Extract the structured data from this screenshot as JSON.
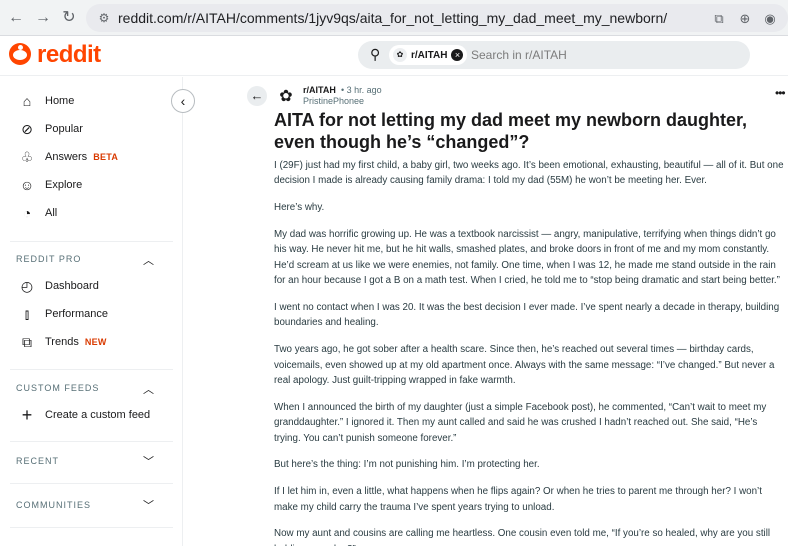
{
  "browser": {
    "url_domain": "reddit.com",
    "url_path": "/r/AITAH/comments/1jyv9qs/aita_for_not_letting_my_dad_meet_my_newborn/"
  },
  "header": {
    "logo_text": "reddit",
    "search_chip": "r/AITAH",
    "search_placeholder": "Search in r/AITAH"
  },
  "sidebar": {
    "nav": [
      {
        "label": "Home",
        "icon": "home-icon"
      },
      {
        "label": "Popular",
        "icon": "popular-icon"
      },
      {
        "label": "Answers",
        "badge": "BETA",
        "icon": "answers-icon"
      },
      {
        "label": "Explore",
        "icon": "explore-icon"
      },
      {
        "label": "All",
        "icon": "all-icon"
      }
    ],
    "reddit_pro_header": "REDDIT PRO",
    "pro": [
      {
        "label": "Dashboard",
        "icon": "dashboard-icon"
      },
      {
        "label": "Performance",
        "icon": "performance-icon"
      },
      {
        "label": "Trends",
        "badge": "NEW",
        "icon": "trends-icon"
      }
    ],
    "custom_feeds_header": "CUSTOM FEEDS",
    "create_feed": "Create a custom feed",
    "recent_header": "RECENT",
    "communities_header": "COMMUNITIES"
  },
  "post": {
    "subreddit": "r/AITAH",
    "time": "• 3 hr. ago",
    "author": "PristinePhonee",
    "title": "AITA for not letting my dad meet my newborn daughter, even though he’s “changed”?",
    "paragraphs": [
      "I (29F) just had my first child, a baby girl, two weeks ago. It’s been emotional, exhausting, beautiful — all of it. But one decision I made is already causing family drama: I told my dad (55M) he won’t be meeting her. Ever.",
      "Here’s why.",
      "My dad was horrific growing up. He was a textbook narcissist — angry, manipulative, terrifying when things didn’t go his way. He never hit me, but he hit walls, smashed plates, and broke doors in front of me and my mom constantly. He’d scream at us like we were enemies, not family. One time, when I was 12, he made me stand outside in the rain for an hour because I got a B on a math test. When I cried, he told me to “stop being dramatic and start being better.”",
      "I went no contact when I was 20. It was the best decision I ever made. I’ve spent nearly a decade in therapy, building boundaries and healing.",
      "Two years ago, he got sober after a health scare. Since then, he’s reached out several times — birthday cards, voicemails, even showed up at my old apartment once. Always with the same message: “I’ve changed.” But never a real apology. Just guilt-tripping wrapped in fake warmth.",
      "When I announced the birth of my daughter (just a simple Facebook post), he commented, “Can’t wait to meet my granddaughter.” I ignored it. Then my aunt called and said he was crushed I hadn’t reached out. She said, “He’s trying. You can’t punish someone forever.”",
      "But here’s the thing: I’m not punishing him. I’m protecting her.",
      "If I let him in, even a little, what happens when he flips again? Or when he tries to parent me through her? I won’t make my child carry the trauma I’ve spent years trying to unload.",
      "Now my aunt and cousins are calling me heartless. One cousin even told me, “If you’re so healed, why are you still holding a grudge?”"
    ]
  },
  "colors": {
    "brand": "#ff4500",
    "badge": "#d93a00",
    "muted": "#576f76"
  }
}
